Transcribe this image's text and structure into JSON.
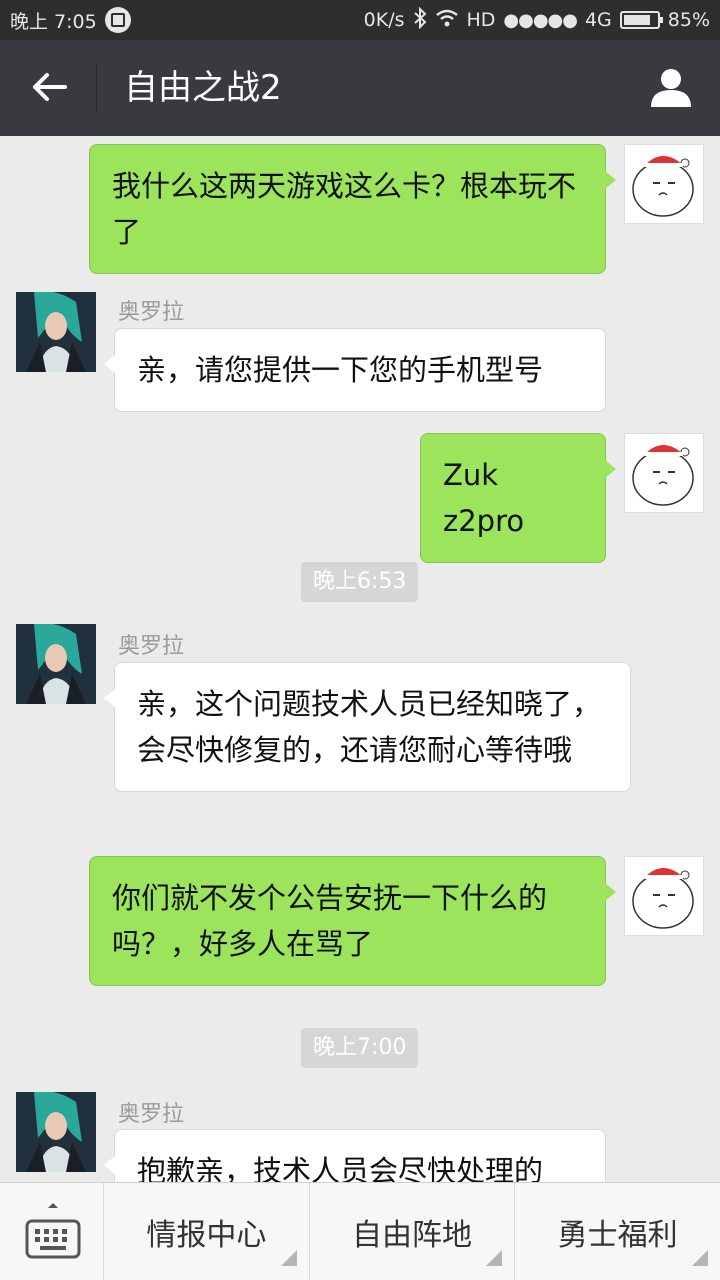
{
  "status_bar": {
    "time": "晚上 7:05",
    "network_speed": "0K/s",
    "hd": "HD",
    "signal_dots": "●●●●●",
    "network_type": "4G",
    "battery_percent": "85%",
    "battery_level": 0.85
  },
  "header": {
    "title": "自由之战2",
    "back_icon": "arrow-left-icon",
    "profile_icon": "person-icon"
  },
  "messages": [
    {
      "from": "me",
      "text": "我什么这两天游戏这么卡？根本玩不了"
    },
    {
      "from": "them",
      "sender": "奥罗拉",
      "text": "亲，请您提供一下您的手机型号"
    },
    {
      "from": "me",
      "text": "Zuk z2pro"
    },
    {
      "type": "time",
      "text": "晚上6:53"
    },
    {
      "from": "them",
      "sender": "奥罗拉",
      "text": "亲，这个问题技术人员已经知晓了，会尽快修复的，还请您耐心等待哦"
    },
    {
      "from": "me",
      "text": "你们就不发个公告安抚一下什么的吗？，好多人在骂了"
    },
    {
      "type": "time",
      "text": "晚上7:00"
    },
    {
      "from": "them",
      "sender": "奥罗拉",
      "text": "抱歉亲，技术人员会尽快处理的"
    }
  ],
  "bottom_menu": {
    "keyboard_icon": "keyboard-icon",
    "items": [
      "情报中心",
      "自由阵地",
      "勇士福利"
    ]
  },
  "colors": {
    "my_bubble": "#9de45d",
    "their_bubble": "#ffffff",
    "title_bar": "#393a3f",
    "status_bar": "#2e2e2e",
    "chat_bg": "#ebebeb"
  }
}
